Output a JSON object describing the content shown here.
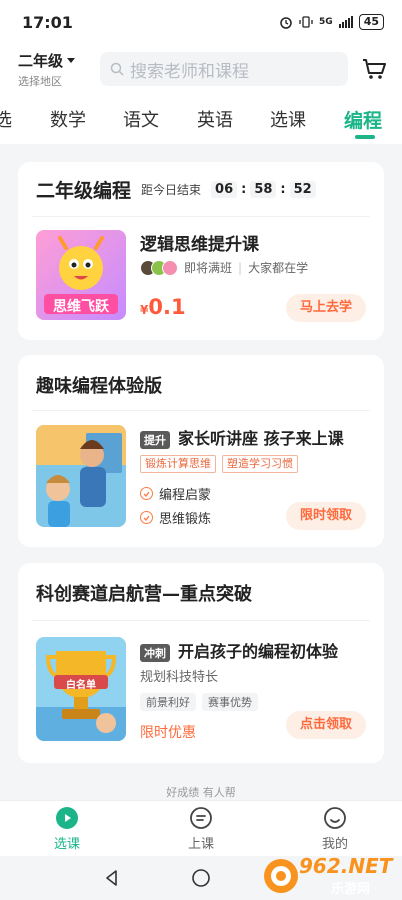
{
  "status": {
    "time": "17:01",
    "network": "5G",
    "battery": "45"
  },
  "header": {
    "grade": "二年级",
    "region": "选择地区",
    "search_placeholder": "搜索老师和课程"
  },
  "tabs": [
    {
      "label": "选"
    },
    {
      "label": "数学"
    },
    {
      "label": "语文"
    },
    {
      "label": "英语"
    },
    {
      "label": "选课"
    },
    {
      "label": "编程",
      "active": true
    }
  ],
  "card1": {
    "title": "二年级编程",
    "countdown_label": "距今日结束",
    "hours": "06",
    "minutes": "58",
    "seconds": "52",
    "course_title": "逻辑思维提升课",
    "thumb_text": "思维飞跃",
    "status": "即将满班",
    "learners": "大家都在学",
    "currency": "¥",
    "price": "0.1",
    "button": "马上去学"
  },
  "card2": {
    "title": "趣味编程体验版",
    "tag": "提升",
    "course_title": "家长听讲座 孩子来上课",
    "chips": [
      "锻炼计算思维",
      "塑造学习习惯"
    ],
    "features": [
      "编程启蒙",
      "思维锻炼"
    ],
    "button": "限时领取"
  },
  "card3": {
    "title": "科创赛道启航营—重点突破",
    "tag": "冲刺",
    "course_title": "开启孩子的编程初体验",
    "subtitle": "规划科技特长",
    "chips": [
      "前景利好",
      "赛事优势"
    ],
    "thumb_text": "白名单",
    "promo": "限时优惠",
    "button": "点击领取"
  },
  "slogan": "好成绩 有人帮",
  "bottom_nav": [
    {
      "label": "选课",
      "active": true
    },
    {
      "label": "上课"
    },
    {
      "label": "我的"
    }
  ],
  "watermark": {
    "site": "962.NET",
    "name": "乐游网"
  },
  "colors": {
    "accent": "#1bb589",
    "price": "#ff5a3c",
    "pill_bg": "#fdeee6"
  }
}
